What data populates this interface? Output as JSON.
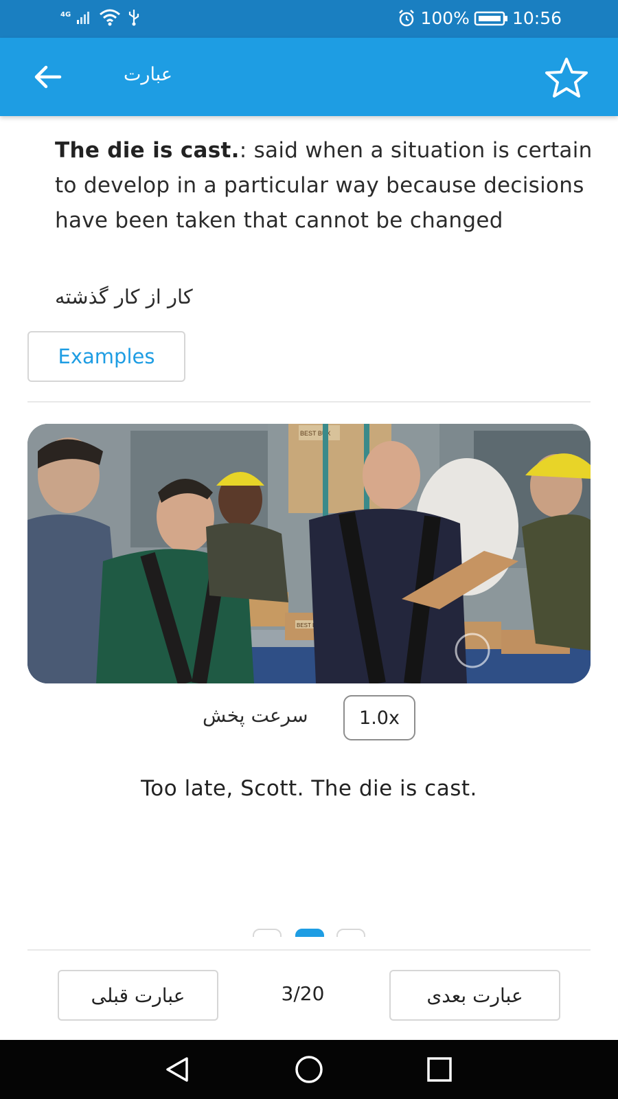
{
  "status_bar": {
    "network": "4G",
    "battery_percent": "100%",
    "time": "10:56"
  },
  "app_bar": {
    "title": "عبارت"
  },
  "phrase": {
    "term": "The die is cast.",
    "definition": ": said when a situation is certain to develop in a particular way because decisions have been taken that cannot be changed",
    "translation": "کار از کار گذشته"
  },
  "examples_button": "Examples",
  "player": {
    "speed_label": "سرعت پخش",
    "speed_value": "1.0x",
    "sentence": "Too late, Scott. The die is cast.",
    "frame_texts": [
      "BEST BUX",
      "BEST BUX",
      "BEST BUX",
      "BEST BUX"
    ]
  },
  "pager": {
    "active_index": 1,
    "count": 3
  },
  "navigation": {
    "previous_label": "عبارت قبلی",
    "next_label": "عبارت بعدی",
    "counter": "3/20"
  },
  "colors": {
    "status_bar": "#1a7fc1",
    "app_bar": "#1e9de3",
    "accent": "#1e9de3",
    "system_nav": "#050505"
  },
  "icons": {
    "back": "arrow-left-icon",
    "favorite": "star-outline-icon",
    "system_back": "triangle-back-icon",
    "system_home": "circle-home-icon",
    "system_recent": "square-recent-icon"
  }
}
